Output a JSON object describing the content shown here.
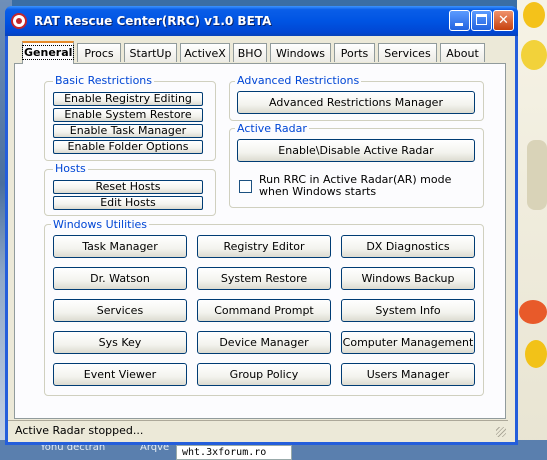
{
  "window": {
    "title": "RAT Rescue Center(RRC) v1.0 BETA"
  },
  "tabs": [
    "General",
    "Procs",
    "StartUp",
    "ActiveX",
    "BHO",
    "Windows",
    "Ports",
    "Services",
    "About"
  ],
  "active_tab": "General",
  "basic": {
    "label": "Basic Restrictions",
    "buttons": [
      "Enable Registry Editing",
      "Enable System Restore",
      "Enable Task Manager",
      "Enable Folder Options"
    ]
  },
  "hosts": {
    "label": "Hosts",
    "buttons": [
      "Reset Hosts",
      "Edit Hosts"
    ]
  },
  "advanced": {
    "label": "Advanced Restrictions",
    "button": "Advanced Restrictions Manager"
  },
  "radar": {
    "label": "Active Radar",
    "button": "Enable\\Disable Active Radar",
    "checkbox_label": "Run RRC in Active Radar(AR) mode when Windows starts",
    "checked": false
  },
  "utilities": {
    "label": "Windows Utilities",
    "rows": [
      [
        "Task Manager",
        "Registry Editor",
        "DX Diagnostics"
      ],
      [
        "Dr. Watson",
        "System Restore",
        "Windows Backup"
      ],
      [
        "Services",
        "Command Prompt",
        "System Info"
      ],
      [
        "Sys Key",
        "Device Manager",
        "Computer Management"
      ],
      [
        "Event Viewer",
        "Group Policy",
        "Users Manager"
      ]
    ]
  },
  "status": {
    "text": "Active Radar stopped..."
  },
  "taskbar": {
    "item": "wht.3xforum.ro",
    "desk_labels": [
      "Yonu dectran",
      "Arqve"
    ]
  }
}
